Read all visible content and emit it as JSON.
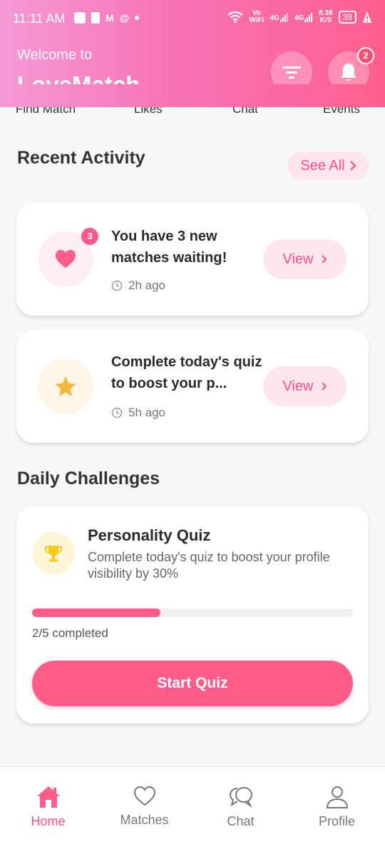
{
  "status_bar": {
    "time": "11:11 AM",
    "net_speed": "8.38",
    "net_unit": "K/S",
    "battery": "38",
    "vo": "Vo",
    "wifi": "WiFi",
    "sig1": "4G",
    "sig2": "4G"
  },
  "header": {
    "welcome": "Welcome to",
    "app_name": "LoveMatch",
    "notification_count": "2"
  },
  "top_tabs": [
    "Find Match",
    "Likes",
    "Chat",
    "Events"
  ],
  "recent_activity": {
    "title": "Recent Activity",
    "see_all": "See All",
    "items": [
      {
        "title": "You have 3 new matches waiting!",
        "time": "2h ago",
        "badge": "3",
        "button": "View",
        "icon": "heart-icon"
      },
      {
        "title": "Complete today's quiz to boost your p...",
        "time": "5h ago",
        "button": "View",
        "icon": "star-icon"
      }
    ]
  },
  "daily_challenges": {
    "title": "Daily Challenges",
    "quiz_title": "Personality Quiz",
    "quiz_description": "Complete today's quiz to boost your profile visibility by 30%",
    "progress_fraction": 0.4,
    "progress_text": "2/5 completed",
    "button": "Start Quiz"
  },
  "bottom_nav": {
    "items": [
      {
        "label": "Home",
        "icon": "home-icon",
        "active": true
      },
      {
        "label": "Matches",
        "icon": "heart-outline-icon",
        "active": false
      },
      {
        "label": "Chat",
        "icon": "chat-icon",
        "active": false
      },
      {
        "label": "Profile",
        "icon": "user-icon",
        "active": false
      }
    ]
  },
  "colors": {
    "accent": "#ff5c8a",
    "accent_light": "#ffe6ee",
    "star": "#f6b53c",
    "trophy": "#f6c91b"
  }
}
